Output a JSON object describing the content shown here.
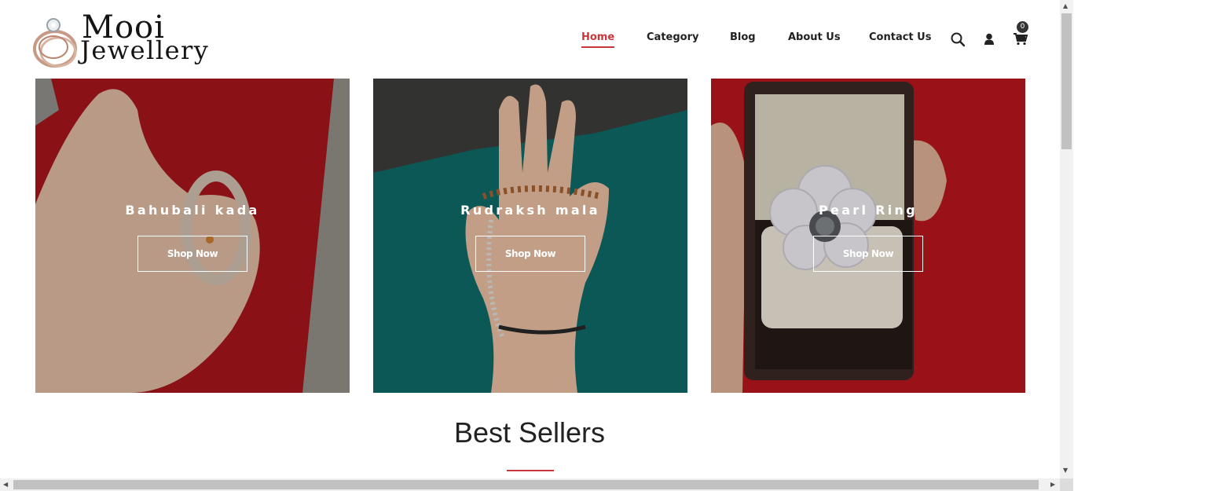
{
  "brand": {
    "line1": "Mooi",
    "line2": "Jewellery"
  },
  "nav": [
    {
      "label": "Home",
      "active": true
    },
    {
      "label": "Category",
      "active": false
    },
    {
      "label": "Blog",
      "active": false
    },
    {
      "label": "About Us",
      "active": false
    },
    {
      "label": "Contact Us",
      "active": false
    }
  ],
  "header_icons": [
    "search-icon",
    "user-icon",
    "cart-icon"
  ],
  "cart": {
    "count": "0"
  },
  "banners": [
    {
      "title": "Bahubali kada",
      "button": "Shop Now"
    },
    {
      "title": "Rudraksh mala",
      "button": "Shop Now"
    },
    {
      "title": "Pearl Ring",
      "button": "Shop Now"
    }
  ],
  "best_sellers": {
    "title": "Best Sellers"
  },
  "colors": {
    "accent": "#c8373c",
    "text": "#222222"
  }
}
